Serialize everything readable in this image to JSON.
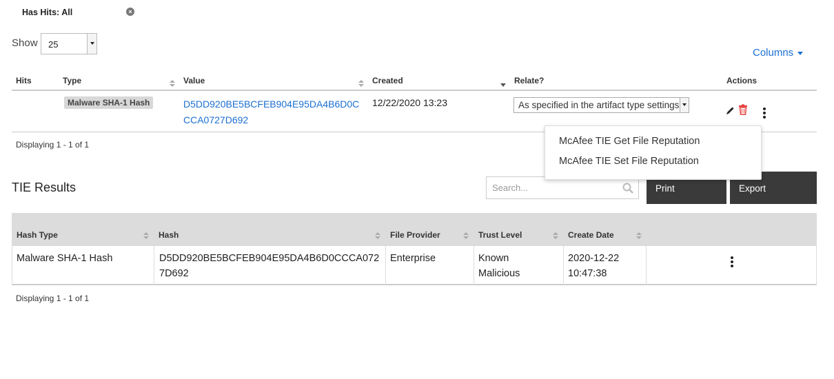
{
  "filter": {
    "label": "Has Hits: All"
  },
  "show": {
    "label": "Show",
    "value": "25"
  },
  "columns_label": "Columns",
  "artifacts_table": {
    "headers": {
      "hits": "Hits",
      "type": "Type",
      "value": "Value",
      "created": "Created",
      "relate": "Relate?",
      "actions": "Actions"
    },
    "row": {
      "type": "Malware SHA-1 Hash",
      "value": "D5DD920BE5BCFEB904E95DA4B6D0CCCA0727D692",
      "created": "12/22/2020 13:23",
      "relate": "As specified in the artifact type settings"
    },
    "displaying": "Displaying 1 - 1 of 1"
  },
  "menu": {
    "items": [
      "McAfee TIE Get File Reputation",
      "McAfee TIE Set File Reputation"
    ]
  },
  "tie": {
    "title": "TIE Results",
    "search_placeholder": "Search...",
    "print_label": "Print",
    "export_label": "Export",
    "headers": {
      "hash_type": "Hash Type",
      "hash": "Hash",
      "file_provider": "File Provider",
      "trust_level": "Trust Level",
      "create_date": "Create Date"
    },
    "row": {
      "hash_type": "Malware SHA-1 Hash",
      "hash": "D5DD920BE5BCFEB904E95DA4B6D0CCCA0727D692",
      "file_provider": "Enterprise",
      "trust_level": "Known Malicious",
      "create_date": "2020-12-22 10:47:38"
    },
    "displaying": "Displaying 1 - 1 of 1"
  },
  "colors": {
    "link": "#1b6fd1",
    "button_dark": "#3a3a3a",
    "trash": "#e53935"
  }
}
